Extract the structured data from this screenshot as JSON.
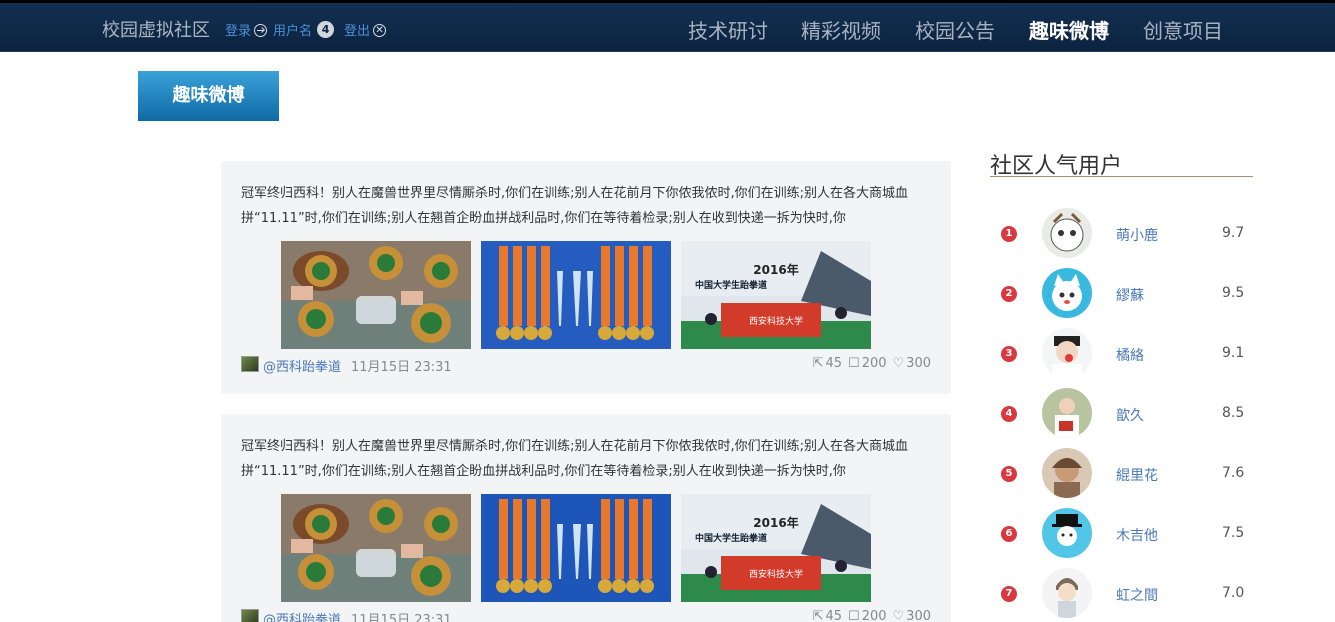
{
  "header": {
    "brand": "校园虚拟社区",
    "login": "登录",
    "username": "用户名",
    "notify_count": "4",
    "logout": "登出",
    "nav": [
      {
        "label": "技术研讨",
        "active": false
      },
      {
        "label": "精彩视频",
        "active": false
      },
      {
        "label": "校园公告",
        "active": false
      },
      {
        "label": "趣味微博",
        "active": true
      },
      {
        "label": "创意项目",
        "active": false
      }
    ]
  },
  "page": {
    "section_button": "趣味微博"
  },
  "posts": [
    {
      "text": "冠军终归西科！别人在魔兽世界里尽情厮杀时,你们在训练;别人在花前月下你侬我侬时,你们在训练;别人在各大商城血拼“11.11”时,你们在训练;别人在翘首企盼血拼战利品时,你们在等待着检录;别人在收到快递一拆为快时,你",
      "author": "@西科跆拳道",
      "time": "11月15日 23:31",
      "shares": "45",
      "comments": "200",
      "likes": "300",
      "banner_text": "2016年",
      "banner_sub": "中国大学生跆拳道",
      "banner_flag": "西安科技大学"
    },
    {
      "text": "冠军终归西科！别人在魔兽世界里尽情厮杀时,你们在训练;别人在花前月下你侬我侬时,你们在训练;别人在各大商城血拼“11.11”时,你们在训练;别人在翘首企盼血拼战利品时,你们在等待着检录;别人在收到快递一拆为快时,你",
      "author": "@西科跆拳道",
      "time": "11月15日 23:31",
      "shares": "45",
      "comments": "200",
      "likes": "300",
      "banner_text": "2016年",
      "banner_sub": "中国大学生跆拳道",
      "banner_flag": "西安科技大学"
    }
  ],
  "sidebar": {
    "title": "社区人气用户",
    "users": [
      {
        "rank": "1",
        "name": "萌小鹿",
        "score": "9.7"
      },
      {
        "rank": "2",
        "name": "繆蘇",
        "score": "9.5"
      },
      {
        "rank": "3",
        "name": "橘絡",
        "score": "9.1"
      },
      {
        "rank": "4",
        "name": "歆久",
        "score": "8.5"
      },
      {
        "rank": "5",
        "name": "緄里花",
        "score": "7.6"
      },
      {
        "rank": "6",
        "name": "木吉他",
        "score": "7.5"
      },
      {
        "rank": "7",
        "name": "虹之間",
        "score": "7.0"
      }
    ]
  },
  "colors": {
    "topbar": "#0c2340",
    "accent_button": "#1a7cbf",
    "rank_badge": "#d9383f",
    "link": "#4a78b8"
  }
}
